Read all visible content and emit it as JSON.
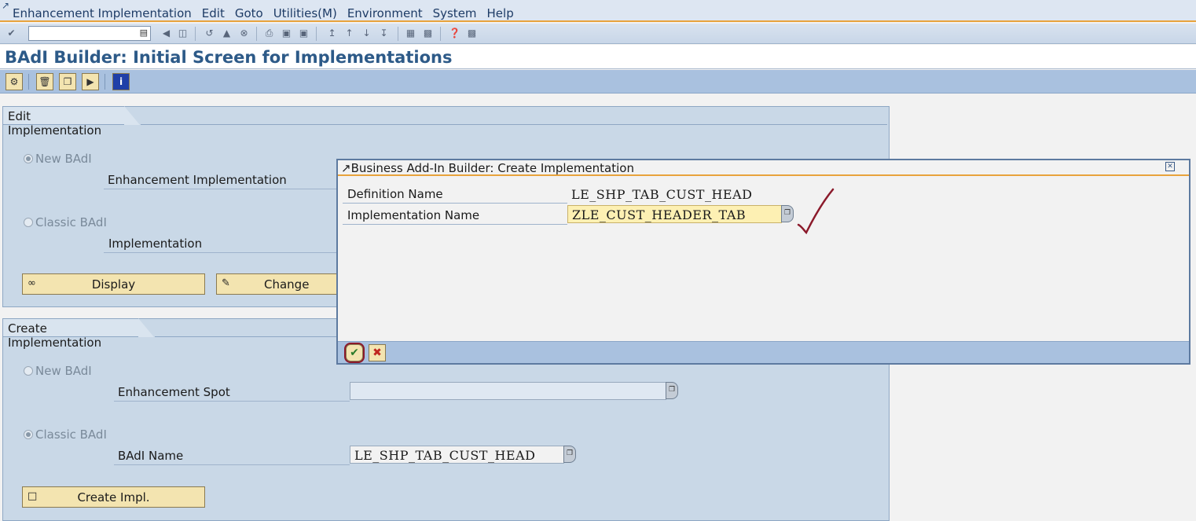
{
  "menubar": {
    "items": [
      "Enhancement Implementation",
      "Edit",
      "Goto",
      "Utilities(M)",
      "Environment",
      "System",
      "Help"
    ]
  },
  "stdbar": {
    "okcode_value": ""
  },
  "title": "BAdI Builder: Initial Screen for Implementations",
  "edit_group": {
    "title": "Edit Implementation",
    "radio_new": "New BAdI",
    "label_enh_impl": "Enhancement Implementation",
    "radio_classic": "Classic BAdI",
    "label_impl": "Implementation",
    "display_button": "Display",
    "change_button": "Change"
  },
  "create_group": {
    "title": "Create Implementation",
    "radio_new": "New BAdI",
    "label_enh_spot": "Enhancement Spot",
    "enh_spot_value": "",
    "radio_classic": "Classic BAdI",
    "label_badi_name": "BAdI Name",
    "badi_name_value": "LE_SHP_TAB_CUST_HEAD",
    "create_button": "Create Impl."
  },
  "dialog": {
    "title": "Business Add-In Builder: Create Implementation",
    "definition_label": "Definition Name",
    "definition_value": "LE_SHP_TAB_CUST_HEAD",
    "impl_label": "Implementation Name",
    "impl_value": "ZLE_CUST_HEADER_TAB"
  },
  "colors": {
    "accent_orange": "#e8a33c",
    "toolbar_blue": "#a9c1df",
    "group_bg": "#c9d8e7",
    "button_yellow": "#f3e4b0",
    "title_blue": "#2d5a88",
    "annotation_red": "#8b1a2b"
  }
}
